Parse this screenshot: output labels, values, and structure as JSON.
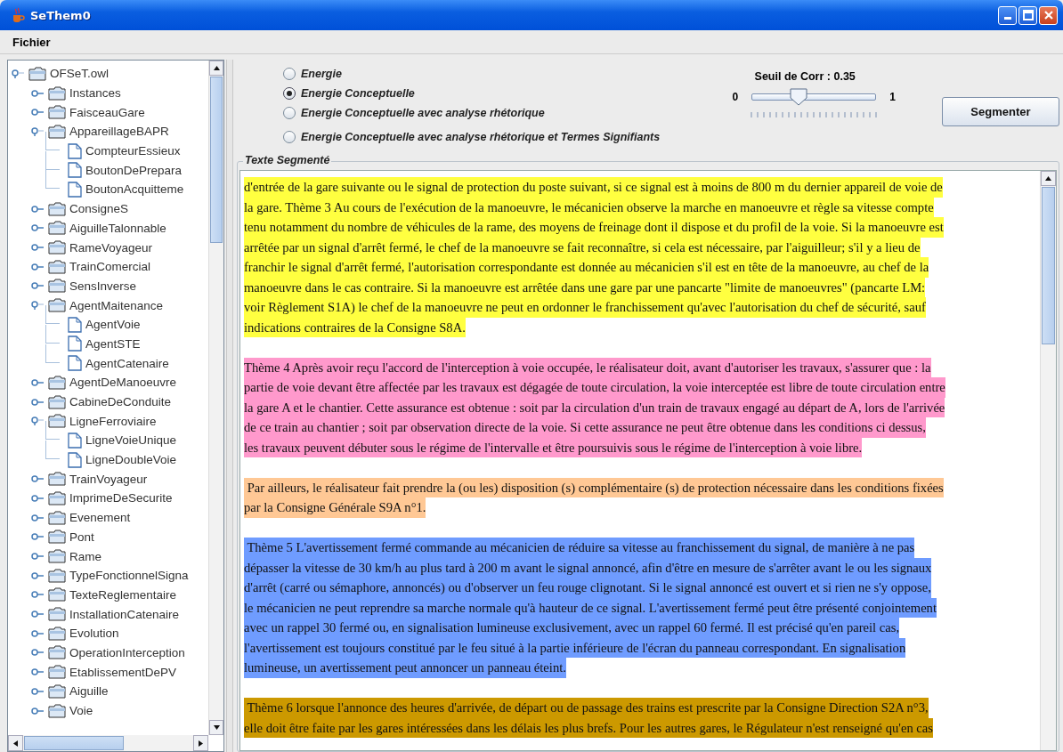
{
  "window": {
    "title": "SeThem0"
  },
  "menu": [
    "Fichier"
  ],
  "tree": [
    {
      "label": "OFSeT.owl",
      "kind": "folder",
      "expanded": true,
      "children": [
        {
          "label": "Instances",
          "kind": "folder",
          "expanded": false
        },
        {
          "label": "FaisceauGare",
          "kind": "folder",
          "expanded": false
        },
        {
          "label": "AppareillageBAPR",
          "kind": "folder",
          "expanded": true,
          "children": [
            {
              "label": "CompteurEssieux",
              "kind": "file"
            },
            {
              "label": "BoutonDePrepara",
              "kind": "file"
            },
            {
              "label": "BoutonAcquitteme",
              "kind": "file"
            }
          ]
        },
        {
          "label": "ConsigneS",
          "kind": "folder",
          "expanded": false
        },
        {
          "label": "AiguilleTalonnable",
          "kind": "folder",
          "expanded": false
        },
        {
          "label": "RameVoyageur",
          "kind": "folder",
          "expanded": false
        },
        {
          "label": "TrainComercial",
          "kind": "folder",
          "expanded": false
        },
        {
          "label": "SensInverse",
          "kind": "folder",
          "expanded": false
        },
        {
          "label": "AgentMaitenance",
          "kind": "folder",
          "expanded": true,
          "children": [
            {
              "label": "AgentVoie",
              "kind": "file"
            },
            {
              "label": "AgentSTE",
              "kind": "file"
            },
            {
              "label": "AgentCatenaire",
              "kind": "file"
            }
          ]
        },
        {
          "label": "AgentDeManoeuvre",
          "kind": "folder",
          "expanded": false
        },
        {
          "label": "CabineDeConduite",
          "kind": "folder",
          "expanded": false
        },
        {
          "label": "LigneFerroviaire",
          "kind": "folder",
          "expanded": true,
          "children": [
            {
              "label": "LigneVoieUnique",
              "kind": "file"
            },
            {
              "label": "LigneDoubleVoie",
              "kind": "file"
            }
          ]
        },
        {
          "label": "TrainVoyageur",
          "kind": "folder",
          "expanded": false
        },
        {
          "label": "ImprimeDeSecurite",
          "kind": "folder",
          "expanded": false
        },
        {
          "label": "Evenement",
          "kind": "folder",
          "expanded": false
        },
        {
          "label": "Pont",
          "kind": "folder",
          "expanded": false
        },
        {
          "label": "Rame",
          "kind": "folder",
          "expanded": false
        },
        {
          "label": "TypeFonctionnelSigna",
          "kind": "folder",
          "expanded": false
        },
        {
          "label": "TexteReglementaire",
          "kind": "folder",
          "expanded": false
        },
        {
          "label": "InstallationCatenaire",
          "kind": "folder",
          "expanded": false
        },
        {
          "label": "Evolution",
          "kind": "folder",
          "expanded": false
        },
        {
          "label": "OperationInterception",
          "kind": "folder",
          "expanded": false
        },
        {
          "label": "EtablissementDePV",
          "kind": "folder",
          "expanded": false
        },
        {
          "label": "Aiguille",
          "kind": "folder",
          "expanded": false
        },
        {
          "label": "Voie",
          "kind": "folder",
          "expanded": false
        }
      ]
    }
  ],
  "methods": [
    {
      "label": "Energie",
      "selected": false
    },
    {
      "label": "Energie Conceptuelle",
      "selected": true
    },
    {
      "label": "Energie Conceptuelle avec analyse rhétorique",
      "selected": false
    },
    {
      "label": "Energie Conceptuelle avec analyse rhétorique et Termes Signifiants",
      "selected": false
    }
  ],
  "threshold": {
    "label": "Seuil de Corr : 0.35",
    "min": "0",
    "max": "1",
    "level": 0.35
  },
  "segment_button": "Segmenter",
  "segmented_text": {
    "title": "Texte Segmenté",
    "segments": [
      {
        "color": "#ffff40",
        "lines": [
          "d'entrée de la gare suivante ou le signal de protection du poste suivant, si ce signal est à moins de 800 m du dernier appareil de voie de",
          "la gare. Thème 3 Au cours de l'exécution de la manoeuvre, le mécanicien observe la marche en manoeuvre et règle sa vitesse compte",
          "tenu notamment du nombre de véhicules de la rame, des moyens de freinage dont il dispose et du profil de la voie. Si la manoeuvre est",
          "arrêtée par un signal d'arrêt fermé, le chef de la manoeuvre se fait reconnaître, si cela est nécessaire, par l'aiguilleur; s'il y a lieu de",
          "franchir le signal d'arrêt fermé, l'autorisation correspondante est donnée au mécanicien s'il est en tête de la manoeuvre, au chef de la",
          "manoeuvre dans le cas contraire. Si la manoeuvre est arrêtée dans une gare par une pancarte \"limite de manoeuvres\" (pancarte LM:",
          "voir Règlement S1A) le chef de la manoeuvre ne peut en ordonner le franchissement qu'avec l'autorisation du chef de sécurité, sauf",
          "indications contraires de la Consigne S8A."
        ]
      },
      {
        "color": "#ff99cc",
        "lines": [
          "Thème 4 Après avoir reçu l'accord de l'interception à voie occupée, le réalisateur doit, avant d'autoriser les travaux, s'assurer que : la",
          "partie de voie devant être affectée par les travaux est dégagée de toute circulation, la voie interceptée est libre de toute circulation entre",
          "la gare A et le chantier. Cette assurance est obtenue : soit par la circulation d'un train de travaux engagé au départ de A, lors de l'arrivée",
          "de ce train au chantier ; soit par observation directe de la voie. Si cette assurance ne peut être obtenue dans les conditions ci dessus,",
          "les travaux peuvent débuter sous le régime de l'intervalle et être poursuivis sous le régime de l'interception à voie libre."
        ]
      },
      {
        "color": "#ffc895",
        "lines": [
          " Par ailleurs, le réalisateur fait prendre la (ou les) disposition (s) complémentaire (s) de protection nécessaire dans les conditions fixées",
          "par la Consigne Générale S9A n°1."
        ]
      },
      {
        "color": "#6f9cff",
        "lines": [
          " Thème 5 L'avertissement fermé commande au mécanicien de réduire sa vitesse au franchissement du signal, de manière à ne pas",
          "dépasser la vitesse de 30 km/h au plus tard à 200 m avant le signal annoncé, afin d'être en mesure de s'arrêter avant le ou les signaux",
          "d'arrêt (carré ou sémaphore, annoncés) ou d'observer un feu rouge clignotant. Si le signal annoncé est ouvert et si rien ne s'y oppose,",
          "le mécanicien ne peut reprendre sa marche normale qu'à hauteur de ce signal. L'avertissement fermé peut être présenté conjointement",
          "avec un rappel 30 fermé ou, en signalisation lumineuse exclusivement, avec un rappel 60 fermé. Il est précisé qu'en pareil cas,",
          "l'avertissement est toujours constitué par le feu situé à la partie inférieure de l'écran du panneau correspondant. En signalisation",
          "lumineuse, un avertissement peut annoncer un panneau éteint."
        ]
      },
      {
        "color": "#cc9900",
        "lines": [
          " Thème 6 lorsque l'annonce des heures d'arrivée, de départ ou de passage des trains est prescrite par la Consigne Direction S2A n°3,",
          "elle doit être faite par les gares intéressées dans les délais les plus brefs. Pour les autres gares, le Régulateur n'est renseigné qu'en cas"
        ]
      }
    ]
  }
}
